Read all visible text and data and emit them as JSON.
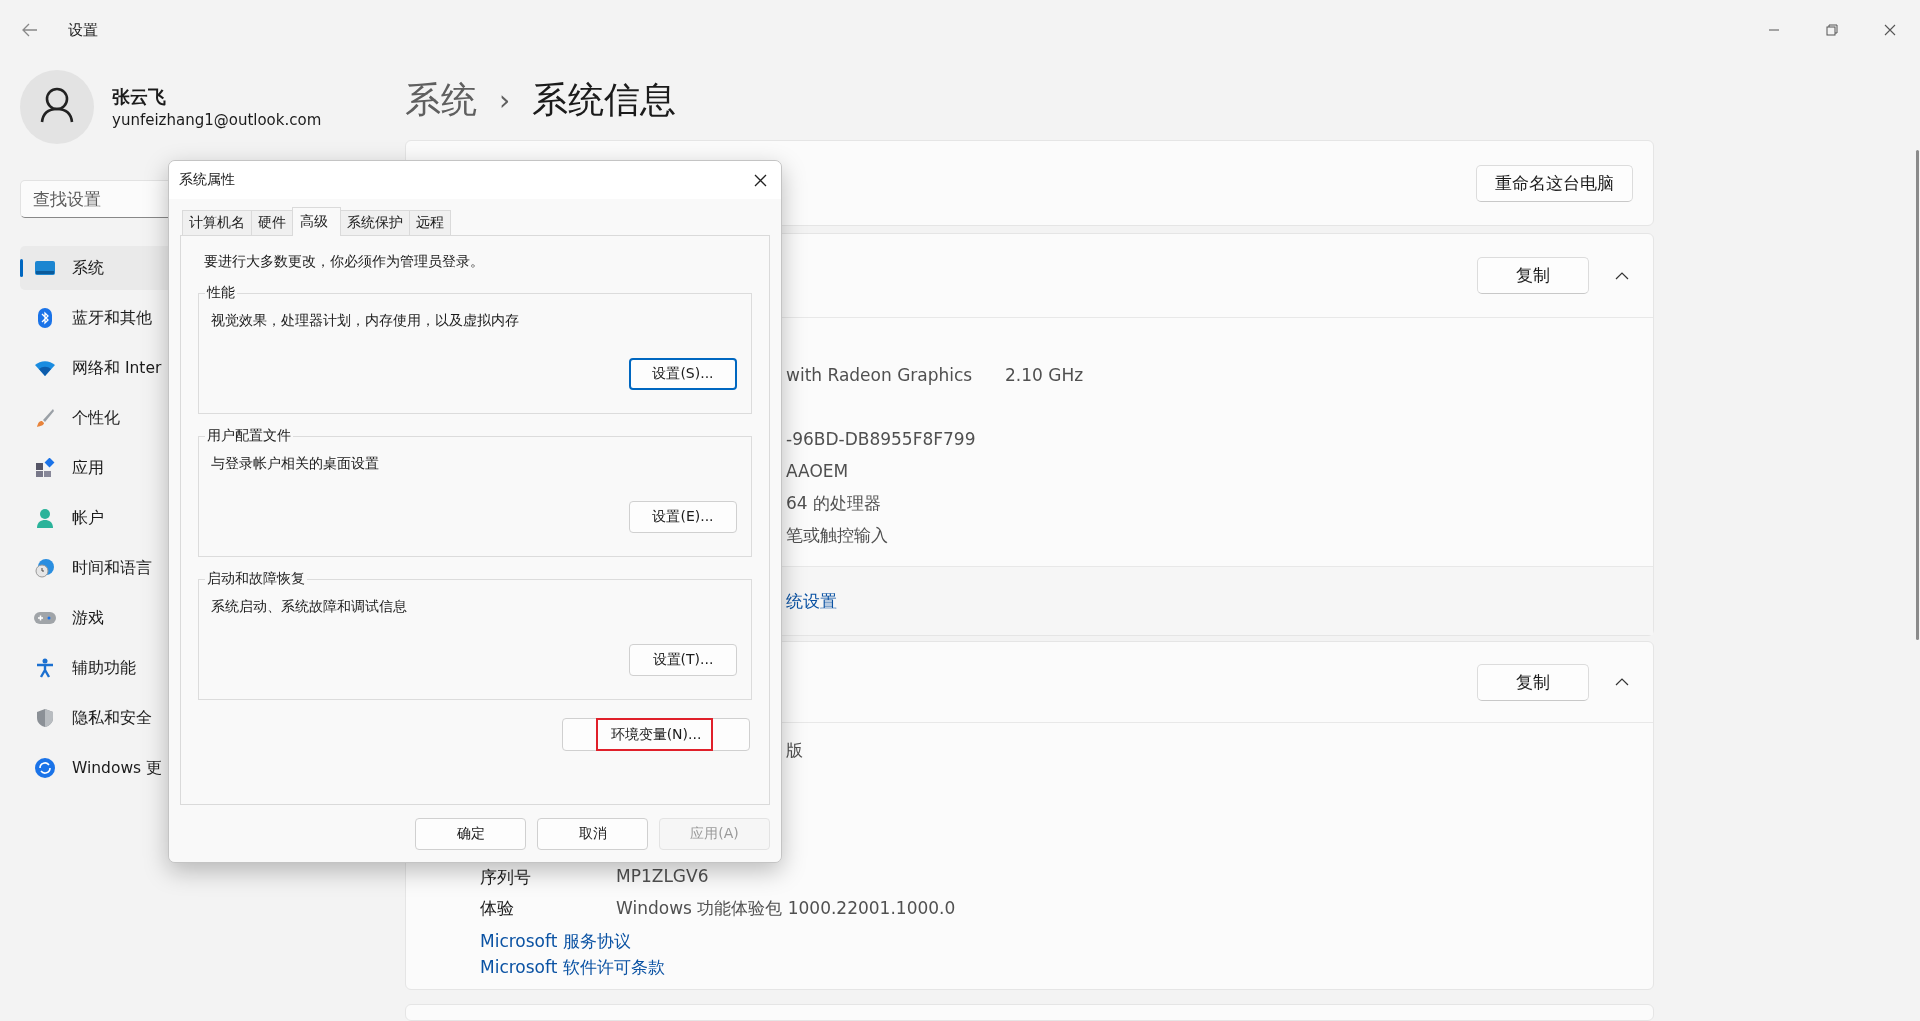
{
  "titlebar": {
    "title": "设置"
  },
  "account": {
    "name": "张云飞",
    "email": "yunfeizhang1@outlook.com"
  },
  "search": {
    "placeholder": "查找设置"
  },
  "nav": [
    {
      "label": "系统",
      "selected": true
    },
    {
      "label": "蓝牙和其他",
      "selected": false
    },
    {
      "label": "网络和 Inter",
      "selected": false
    },
    {
      "label": "个性化",
      "selected": false
    },
    {
      "label": "应用",
      "selected": false
    },
    {
      "label": "帐户",
      "selected": false
    },
    {
      "label": "时间和语言",
      "selected": false
    },
    {
      "label": "游戏",
      "selected": false
    },
    {
      "label": "辅助功能",
      "selected": false
    },
    {
      "label": "隐私和安全",
      "selected": false
    },
    {
      "label": "Windows 更",
      "selected": false
    }
  ],
  "breadcrumb": {
    "parent": "系统",
    "separator": "›",
    "current": "系统信息"
  },
  "rename_button": "重命名这台电脑",
  "device_card": {
    "copy_button": "复制",
    "expanded": true,
    "rows": [
      {
        "value": "with Radeon Graphics",
        "extra": "2.10 GHz"
      },
      {},
      {
        "value": "-96BD-DB8955F8F799"
      },
      {
        "value": "AAOEM"
      },
      {
        "value": "64 的处理器"
      },
      {
        "value": "笔或触控输入"
      }
    ],
    "footer_link": "统设置"
  },
  "windows_card": {
    "copy_button": "复制",
    "expanded": true,
    "fragment": "版",
    "rows": [
      {
        "label": "序列号",
        "value": "MP1ZLGV6"
      },
      {
        "label": "体验",
        "value": "Windows 功能体验包 1000.22001.1000.0"
      }
    ],
    "links": [
      "Microsoft 服务协议",
      "Microsoft 软件许可条款"
    ]
  },
  "dialog": {
    "title": "系统属性",
    "tabs": [
      {
        "label": "计算机名",
        "selected": false
      },
      {
        "label": "硬件",
        "selected": false
      },
      {
        "label": "高级",
        "selected": true
      },
      {
        "label": "系统保护",
        "selected": false
      },
      {
        "label": "远程",
        "selected": false
      }
    ],
    "notice": "要进行大多数更改，你必须作为管理员登录。",
    "groups": [
      {
        "title": "性能",
        "description": "视觉效果，处理器计划，内存使用，以及虚拟内存",
        "button": {
          "label": "设置(S)...",
          "focused": true
        }
      },
      {
        "title": "用户配置文件",
        "description": "与登录帐户相关的桌面设置",
        "button": {
          "label": "设置(E)...",
          "focused": false
        }
      },
      {
        "title": "启动和故障恢复",
        "description": "系统启动、系统故障和调试信息",
        "button": {
          "label": "设置(T)...",
          "focused": false
        }
      }
    ],
    "env_button": {
      "label": "环境变量(N)...",
      "highlighted": true
    },
    "buttons": [
      {
        "label": "确定",
        "disabled": false
      },
      {
        "label": "取消",
        "disabled": false
      },
      {
        "label": "应用(A)",
        "disabled": true
      }
    ]
  }
}
